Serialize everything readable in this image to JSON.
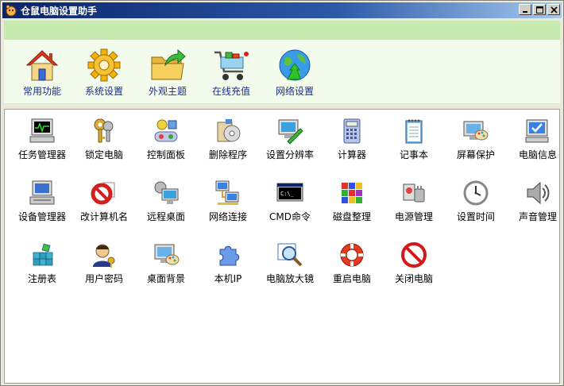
{
  "window": {
    "title": "仓鼠电脑设置助手"
  },
  "toolbar": {
    "items": [
      {
        "label": "常用功能",
        "icon": "home-icon"
      },
      {
        "label": "系统设置",
        "icon": "gear-icon"
      },
      {
        "label": "外观主题",
        "icon": "folder-arrow-icon"
      },
      {
        "label": "在线充值",
        "icon": "shopping-cart-icon"
      },
      {
        "label": "网络设置",
        "icon": "globe-icon"
      }
    ]
  },
  "grid": {
    "items": [
      {
        "label": "任务管理器",
        "icon": "task-manager-icon"
      },
      {
        "label": "锁定电脑",
        "icon": "keys-icon"
      },
      {
        "label": "控制面板",
        "icon": "control-panel-icon"
      },
      {
        "label": "删除程序",
        "icon": "uninstall-icon"
      },
      {
        "label": "设置分辨率",
        "icon": "display-settings-icon"
      },
      {
        "label": "计算器",
        "icon": "calculator-icon"
      },
      {
        "label": "记事本",
        "icon": "notepad-icon"
      },
      {
        "label": "屏幕保护",
        "icon": "screensaver-icon"
      },
      {
        "label": "电脑信息",
        "icon": "computer-info-icon"
      },
      {
        "label": "设备管理器",
        "icon": "device-manager-icon"
      },
      {
        "label": "改计算机名",
        "icon": "rename-computer-icon"
      },
      {
        "label": "远程桌面",
        "icon": "remote-desktop-icon"
      },
      {
        "label": "网络连接",
        "icon": "network-connection-icon"
      },
      {
        "label": "CMD命令",
        "icon": "cmd-icon"
      },
      {
        "label": "磁盘整理",
        "icon": "defrag-icon"
      },
      {
        "label": "电源管理",
        "icon": "power-management-icon"
      },
      {
        "label": "设置时间",
        "icon": "clock-icon"
      },
      {
        "label": "声音管理",
        "icon": "speaker-icon"
      },
      {
        "label": "注册表",
        "icon": "registry-icon"
      },
      {
        "label": "用户密码",
        "icon": "user-password-icon"
      },
      {
        "label": "桌面背景",
        "icon": "desktop-background-icon"
      },
      {
        "label": "本机IP",
        "icon": "puzzle-icon"
      },
      {
        "label": "电脑放大镜",
        "icon": "magnifier-icon"
      },
      {
        "label": "重启电脑",
        "icon": "restart-icon"
      },
      {
        "label": "关闭电脑",
        "icon": "shutdown-icon"
      }
    ]
  },
  "colors": {
    "accent": "#1a2f8a",
    "titlebar": "#0a246a",
    "banner": "#c6eab0"
  }
}
